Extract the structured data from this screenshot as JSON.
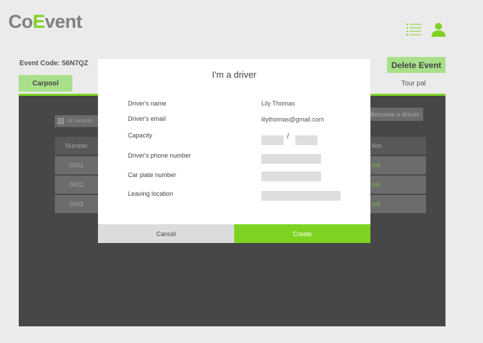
{
  "header": {
    "logo_part1": "Co",
    "logo_accent": "E",
    "logo_part2": "vent",
    "menu_icon": "hamburger-list-icon",
    "user_icon": "user-icon"
  },
  "event": {
    "code_label": "Event Code: 56N7QZ",
    "delete_label": "Delete Event"
  },
  "tabs": [
    {
      "label": "Carpool",
      "active": true
    },
    {
      "label": "Tour pal",
      "active": false
    }
  ],
  "carpool": {
    "filter_label": "All carpools",
    "become_driver_label": "Become a driver",
    "columns": {
      "number": "Number",
      "action": "tion"
    },
    "rows": [
      {
        "number": "0001",
        "action": "roll"
      },
      {
        "number": "0002",
        "action": "roll"
      },
      {
        "number": "0003",
        "action": "roll"
      }
    ]
  },
  "modal": {
    "title": "I'm a driver",
    "fields": [
      {
        "label": "Driver's name",
        "value": "Lily Thomas"
      },
      {
        "label": "Driver's email",
        "value": "lilythomas@gmail.com"
      },
      {
        "label": "Capacity",
        "value": "",
        "separator": "/"
      },
      {
        "label": "Driver's phone number",
        "value": ""
      },
      {
        "label": "Car plate number",
        "value": ""
      },
      {
        "label": "Leaving location",
        "value": ""
      }
    ],
    "cancel_label": "Cancel",
    "create_label": "Create"
  },
  "colors": {
    "accent": "#7ed321",
    "accent_light": "#a8e08a",
    "overlay": "#474747",
    "background": "#ebebeb"
  }
}
